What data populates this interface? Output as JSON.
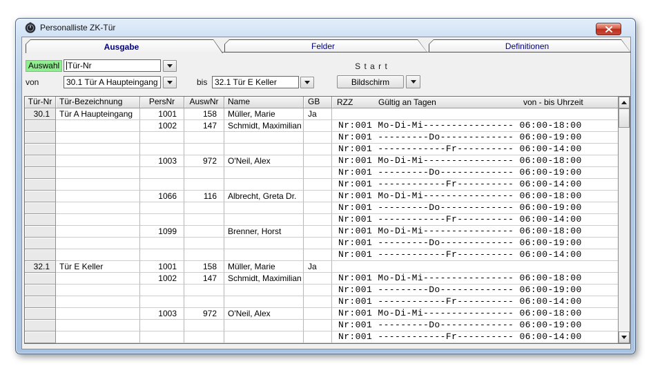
{
  "window": {
    "title": "Personalliste ZK-Tür"
  },
  "colors": {
    "selection_green": "#90EE90",
    "tab_text_navy": "#000080",
    "close_button_red": "#C0392B",
    "frame_blue": "#B2C9E5"
  },
  "tabs": [
    {
      "label": "Ausgabe",
      "active": true
    },
    {
      "label": "Felder",
      "active": false
    },
    {
      "label": "Definitionen",
      "active": false
    }
  ],
  "filters": {
    "auswahl_label": "Auswahl",
    "auswahl_value": "Tür-Nr",
    "von_label": "von",
    "von_value": "30.1 Tür A Haupteingang",
    "bis_label": "bis",
    "bis_value": "32.1 Tür E Keller",
    "start_label": "S t a r t",
    "screen_button_label": "Bildschirm"
  },
  "table": {
    "headers": [
      "Tür-Nr",
      "Tür-Bezeichnung",
      "PersNr",
      "AuswNr",
      "Name",
      "GB"
    ],
    "rzz_header": {
      "rzz": "RZZ",
      "days": "Gültig an Tagen",
      "time": "von - bis Uhrzeit"
    },
    "rows": [
      {
        "tuer": "30.1",
        "bez": "Tür A Haupteingang",
        "pers": "1001",
        "ausw": "158",
        "name": "Müller, Marie",
        "gb": "Ja",
        "rzz": ""
      },
      {
        "tuer": "",
        "bez": "",
        "pers": "1002",
        "ausw": "147",
        "name": "Schmidt, Maximilian",
        "gb": "",
        "rzz": "Nr:001 Mo-Di-Mi---------------- 06:00-18:00"
      },
      {
        "tuer": "",
        "bez": "",
        "pers": "",
        "ausw": "",
        "name": "",
        "gb": "",
        "rzz": "Nr:001 ---------Do------------- 06:00-19:00"
      },
      {
        "tuer": "",
        "bez": "",
        "pers": "",
        "ausw": "",
        "name": "",
        "gb": "",
        "rzz": "Nr:001 ------------Fr---------- 06:00-14:00"
      },
      {
        "tuer": "",
        "bez": "",
        "pers": "1003",
        "ausw": "972",
        "name": "O'Neil, Alex",
        "gb": "",
        "rzz": "Nr:001 Mo-Di-Mi---------------- 06:00-18:00"
      },
      {
        "tuer": "",
        "bez": "",
        "pers": "",
        "ausw": "",
        "name": "",
        "gb": "",
        "rzz": "Nr:001 ---------Do------------- 06:00-19:00"
      },
      {
        "tuer": "",
        "bez": "",
        "pers": "",
        "ausw": "",
        "name": "",
        "gb": "",
        "rzz": "Nr:001 ------------Fr---------- 06:00-14:00"
      },
      {
        "tuer": "",
        "bez": "",
        "pers": "1066",
        "ausw": "116",
        "name": "Albrecht, Greta Dr.",
        "gb": "",
        "rzz": "Nr:001 Mo-Di-Mi---------------- 06:00-18:00"
      },
      {
        "tuer": "",
        "bez": "",
        "pers": "",
        "ausw": "",
        "name": "",
        "gb": "",
        "rzz": "Nr:001 ---------Do------------- 06:00-19:00"
      },
      {
        "tuer": "",
        "bez": "",
        "pers": "",
        "ausw": "",
        "name": "",
        "gb": "",
        "rzz": "Nr:001 ------------Fr---------- 06:00-14:00"
      },
      {
        "tuer": "",
        "bez": "",
        "pers": "1099",
        "ausw": "",
        "name": "Brenner, Horst",
        "gb": "",
        "rzz": "Nr:001 Mo-Di-Mi---------------- 06:00-18:00"
      },
      {
        "tuer": "",
        "bez": "",
        "pers": "",
        "ausw": "",
        "name": "",
        "gb": "",
        "rzz": "Nr:001 ---------Do------------- 06:00-19:00"
      },
      {
        "tuer": "",
        "bez": "",
        "pers": "",
        "ausw": "",
        "name": "",
        "gb": "",
        "rzz": "Nr:001 ------------Fr---------- 06:00-14:00"
      },
      {
        "tuer": "32.1",
        "bez": "Tür E Keller",
        "pers": "1001",
        "ausw": "158",
        "name": "Müller, Marie",
        "gb": "Ja",
        "rzz": ""
      },
      {
        "tuer": "",
        "bez": "",
        "pers": "1002",
        "ausw": "147",
        "name": "Schmidt, Maximilian",
        "gb": "",
        "rzz": "Nr:001 Mo-Di-Mi---------------- 06:00-18:00"
      },
      {
        "tuer": "",
        "bez": "",
        "pers": "",
        "ausw": "",
        "name": "",
        "gb": "",
        "rzz": "Nr:001 ---------Do------------- 06:00-19:00"
      },
      {
        "tuer": "",
        "bez": "",
        "pers": "",
        "ausw": "",
        "name": "",
        "gb": "",
        "rzz": "Nr:001 ------------Fr---------- 06:00-14:00"
      },
      {
        "tuer": "",
        "bez": "",
        "pers": "1003",
        "ausw": "972",
        "name": "O'Neil, Alex",
        "gb": "",
        "rzz": "Nr:001 Mo-Di-Mi---------------- 06:00-18:00"
      },
      {
        "tuer": "",
        "bez": "",
        "pers": "",
        "ausw": "",
        "name": "",
        "gb": "",
        "rzz": "Nr:001 ---------Do------------- 06:00-19:00"
      },
      {
        "tuer": "",
        "bez": "",
        "pers": "",
        "ausw": "",
        "name": "",
        "gb": "",
        "rzz": "Nr:001 ------------Fr---------- 06:00-14:00"
      }
    ]
  }
}
